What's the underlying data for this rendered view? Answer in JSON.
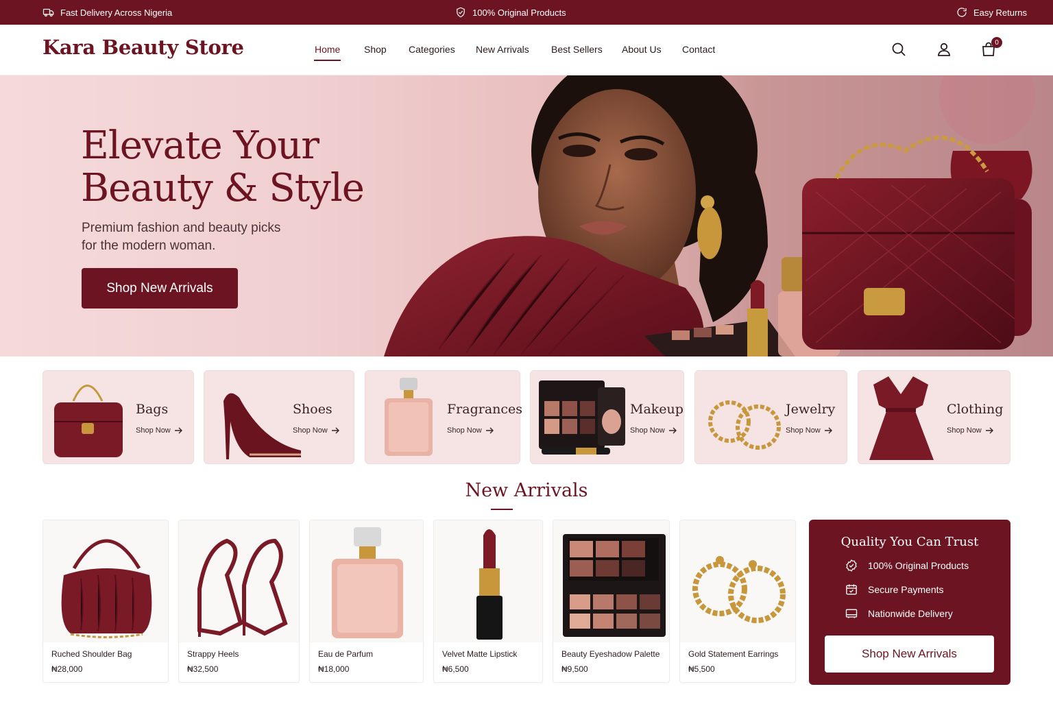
{
  "topbar": {
    "delivery": "Fast Delivery Across Nigeria",
    "original": "100% Original Products",
    "returns": "Easy Returns"
  },
  "header": {
    "logo": "Kara Beauty Store",
    "nav": [
      "Home",
      "Shop",
      "Categories",
      "New Arrivals",
      "Best Sellers",
      "About Us",
      "Contact"
    ],
    "active_nav": "Home",
    "cart_count": "0"
  },
  "hero": {
    "title_line1": "Elevate Your",
    "title_line2": "Beauty & Style",
    "subtitle_line1": "Premium fashion and beauty picks",
    "subtitle_line2": "for the modern woman.",
    "cta": "Shop New Arrivals"
  },
  "categories": [
    {
      "name": "Bags",
      "link": "Shop Now"
    },
    {
      "name": "Shoes",
      "link": "Shop Now"
    },
    {
      "name": "Fragrances",
      "link": "Shop Now"
    },
    {
      "name": "Makeup",
      "link": "Shop Now"
    },
    {
      "name": "Jewelry",
      "link": "Shop Now"
    },
    {
      "name": "Clothing",
      "link": "Shop Now"
    }
  ],
  "new_arrivals": {
    "title": "New Arrivals",
    "products": [
      {
        "name": "Ruched Shoulder Bag",
        "price": "₦28,000"
      },
      {
        "name": "Strappy Heels",
        "price": "₦32,500"
      },
      {
        "name": "Eau de Parfum",
        "price": "₦18,000"
      },
      {
        "name": "Velvet Matte Lipstick",
        "price": "₦6,500"
      },
      {
        "name": "Beauty Eyeshadow Palette",
        "price": "₦9,500"
      },
      {
        "name": "Gold Statement Earrings",
        "price": "₦5,500"
      }
    ]
  },
  "trust": {
    "title": "Quality You Can Trust",
    "items": [
      "100% Original Products",
      "Secure Payments",
      "Nationwide Delivery"
    ],
    "cta": "Shop New Arrivals"
  },
  "colors": {
    "brand": "#6d1422",
    "tile_bg": "#f6e4e5",
    "hero_bg": "#f0cfd0"
  }
}
